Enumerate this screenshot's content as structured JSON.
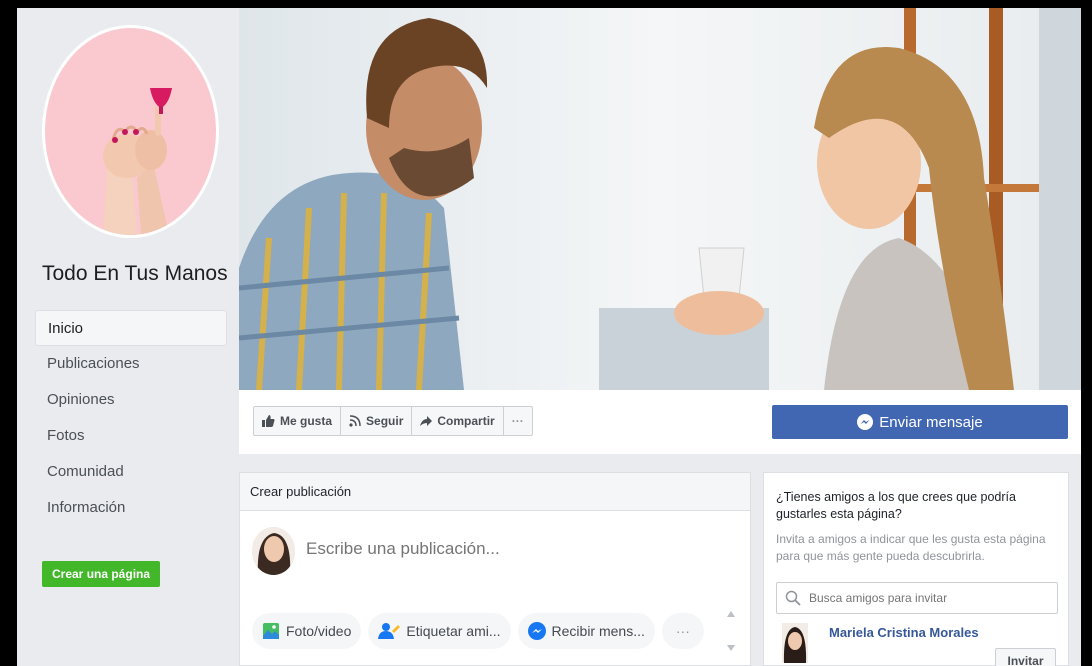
{
  "sidebar": {
    "page_name": "Todo En Tus Manos",
    "nav": [
      {
        "label": "Inicio",
        "active": true
      },
      {
        "label": "Publicaciones",
        "active": false
      },
      {
        "label": "Opiniones",
        "active": false
      },
      {
        "label": "Fotos",
        "active": false
      },
      {
        "label": "Comunidad",
        "active": false
      },
      {
        "label": "Información",
        "active": false
      }
    ],
    "create_page_label": "Crear una página"
  },
  "actions": {
    "like_label": "Me gusta",
    "follow_label": "Seguir",
    "share_label": "Compartir",
    "more_label": "···",
    "send_message_label": "Enviar mensaje"
  },
  "composer": {
    "title": "Crear publicación",
    "placeholder": "Escribe una publicación...",
    "buttons": [
      {
        "label": "Foto/video",
        "icon": "photo-icon"
      },
      {
        "label": "Etiquetar ami...",
        "icon": "tag-friends-icon"
      },
      {
        "label": "Recibir mens...",
        "icon": "messenger-icon"
      }
    ],
    "more_label": "···"
  },
  "invite": {
    "title": "¿Tienes amigos a los que crees que podría gustarles esta página?",
    "description": "Invita a amigos a indicar que les gusta esta página para que más gente pueda descubrirla.",
    "search_placeholder": "Busca amigos para invitar",
    "friend_name": "Mariela Cristina Morales",
    "invite_label": "Invitar"
  },
  "colors": {
    "brand": "#4267b2",
    "create_green": "#42b72a",
    "link": "#365899",
    "background": "#e9ebee"
  }
}
